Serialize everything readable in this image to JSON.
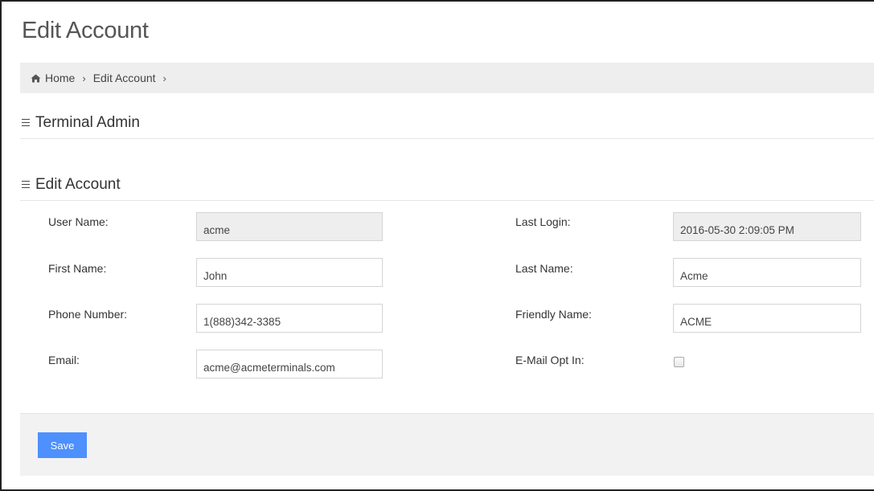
{
  "page": {
    "title": "Edit Account"
  },
  "breadcrumb": {
    "home": "Home",
    "current": "Edit Account",
    "separator": "›"
  },
  "sections": {
    "terminal_admin": "Terminal Admin",
    "edit_account": "Edit Account"
  },
  "form": {
    "user_name": {
      "label": "User Name:",
      "value": "acme",
      "readonly": true
    },
    "last_login": {
      "label": "Last Login:",
      "value": "2016-05-30 2:09:05 PM",
      "readonly": true
    },
    "first_name": {
      "label": "First Name:",
      "value": "John"
    },
    "last_name": {
      "label": "Last Name:",
      "value": "Acme"
    },
    "phone_number": {
      "label": "Phone Number:",
      "value": "1(888)342-3385"
    },
    "friendly_name": {
      "label": "Friendly Name:",
      "value": "ACME"
    },
    "email": {
      "label": "Email:",
      "value": "acme@acmeterminals.com"
    },
    "email_opt_in": {
      "label": "E-Mail Opt In:",
      "checked": false
    }
  },
  "actions": {
    "save_label": "Save"
  },
  "colors": {
    "primary_button": "#4d90fe",
    "breadcrumb_bg": "#eeeeee",
    "footer_bg": "#f2f2f2",
    "readonly_bg": "#eeeeee"
  },
  "icons": {
    "home": "home-icon",
    "section": "hamburger-icon"
  }
}
